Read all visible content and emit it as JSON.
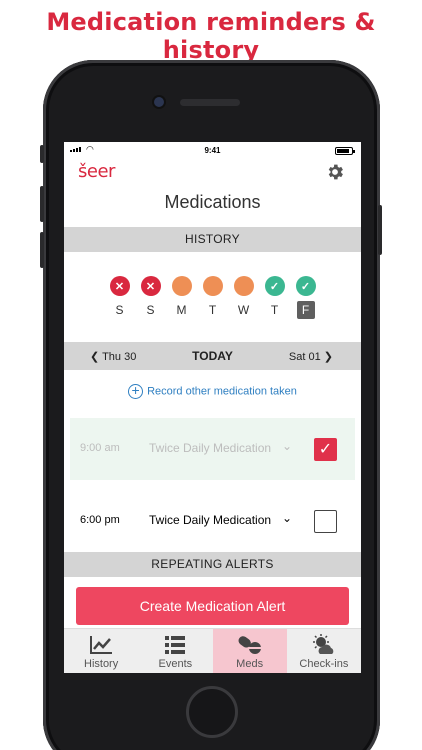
{
  "headline": "Medication reminders & history",
  "status_bar": {
    "time": "9:41"
  },
  "app": {
    "logo": "šeer",
    "settings_icon": "gear-icon"
  },
  "page_title": "Medications",
  "history": {
    "header": "HISTORY",
    "days": [
      {
        "label": "S",
        "status": "missed",
        "mark": "✕"
      },
      {
        "label": "S",
        "status": "missed",
        "mark": "✕"
      },
      {
        "label": "M",
        "status": "partial",
        "mark": ""
      },
      {
        "label": "T",
        "status": "partial",
        "mark": ""
      },
      {
        "label": "W",
        "status": "partial",
        "mark": ""
      },
      {
        "label": "T",
        "status": "taken",
        "mark": "✓"
      },
      {
        "label": "F",
        "status": "taken",
        "mark": "✓",
        "current": true
      }
    ]
  },
  "date_nav": {
    "prev": "Thu 30",
    "current": "TODAY",
    "next": "Sat 01"
  },
  "record_other": "Record other medication taken",
  "medications": [
    {
      "time": "9:00 am",
      "name": "Twice Daily Medication",
      "taken": true
    },
    {
      "time": "6:00 pm",
      "name": "Twice Daily Medication",
      "taken": false
    }
  ],
  "repeating_alerts": {
    "header": "REPEATING ALERTS",
    "create_button": "Create Medication Alert"
  },
  "tabs": [
    {
      "label": "History",
      "icon": "chart-icon",
      "active": false
    },
    {
      "label": "Events",
      "icon": "list-icon",
      "active": false
    },
    {
      "label": "Meds",
      "icon": "pills-icon",
      "active": true
    },
    {
      "label": "Check-ins",
      "icon": "weather-icon",
      "active": false
    }
  ],
  "colors": {
    "brand_red": "#d9283f",
    "button_red": "#ee4760",
    "missed": "#d9283f",
    "partial": "#ee8f55",
    "taken": "#3bb791",
    "link_blue": "#2f7fc1",
    "active_tab": "#f6c6cf"
  }
}
